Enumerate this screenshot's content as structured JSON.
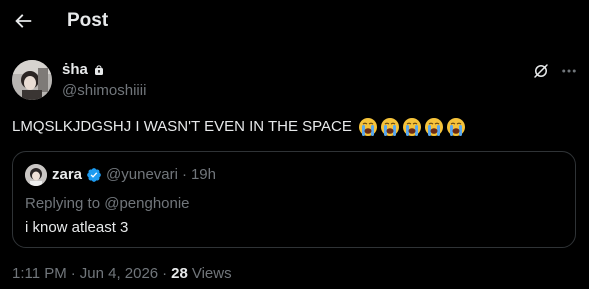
{
  "header": {
    "title": "Post",
    "back_icon": "back-arrow-icon"
  },
  "post": {
    "author_name": "ṡha",
    "author_handle": "@shimoshiiii",
    "protected_icon": "lock-icon",
    "text": "LMQSLKJDGSHJ I WASN'T EVEN IN THE SPACE",
    "emoji_count": 5,
    "emoji_name": "loudly-crying-face-emoji",
    "actions": {
      "grok_icon": "grok-icon",
      "more_icon": "more-dots-icon"
    }
  },
  "quote": {
    "author_name": "zara",
    "verified_icon": "verified-badge-icon",
    "author_handle": "@yunevari",
    "separator": "·",
    "time": "19h",
    "reply_prefix": "Replying to",
    "reply_handle": "@penghonie",
    "text": "i know atleast 3"
  },
  "meta": {
    "time": "1:11 PM",
    "separator1": "·",
    "date": "Jun 4, 2026",
    "separator2": "·",
    "views_count": "28",
    "views_label": "Views"
  },
  "colors": {
    "background": "#000000",
    "text_primary": "#e7e9ea",
    "text_secondary": "#71767b",
    "border": "#2f3336",
    "verified_blue": "#1d9bf0",
    "emoji_yellow": "#f5c33b",
    "emoji_tear_blue": "#5aa8ee"
  }
}
